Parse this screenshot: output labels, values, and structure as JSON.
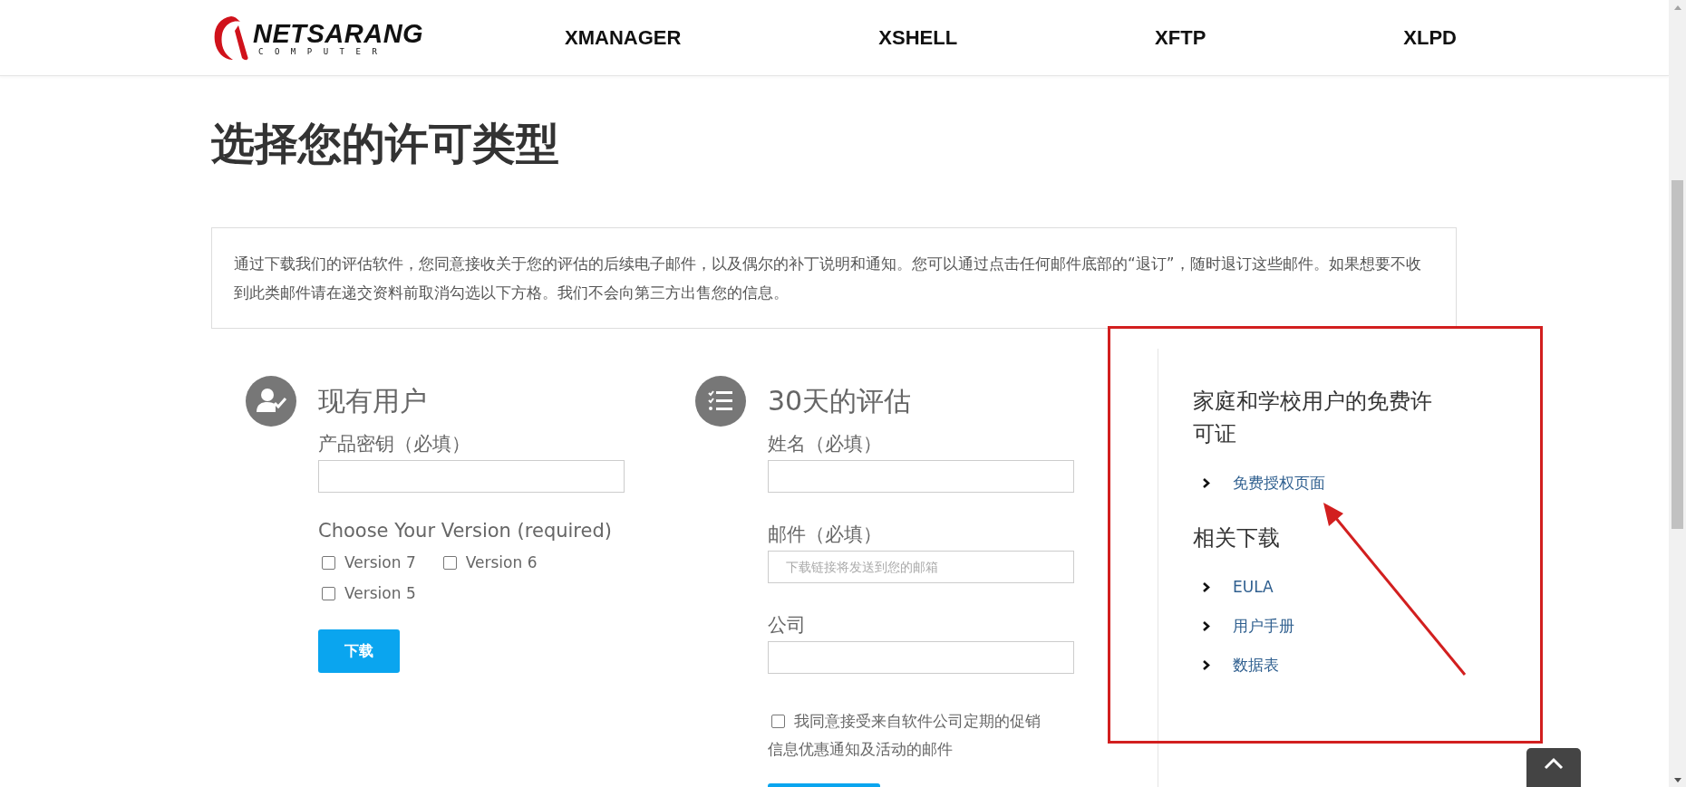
{
  "header": {
    "logo": {
      "name": "NETSARANG",
      "subtitle": "COMPUTER"
    },
    "nav": [
      {
        "label": "XMANAGER"
      },
      {
        "label": "XSHELL"
      },
      {
        "label": "XFTP"
      },
      {
        "label": "XLPD"
      }
    ]
  },
  "page_title": "选择您的许可类型",
  "notice": "通过下载我们的评估软件，您同意接收关于您的评估的后续电子邮件，以及偶尔的补丁说明和通知。您可以通过点击任何邮件底部的“退订”，随时退订这些邮件。如果想要不收到此类邮件请在递交资料前取消勾选以下方格。我们不会向第三方出售您的信息。",
  "existing_user": {
    "heading": "现有用户",
    "fields": [
      {
        "label": "产品密钥（必填）"
      }
    ],
    "version_label": "Choose Your Version (required)",
    "versions": [
      {
        "label": "Version 7",
        "checked": false
      },
      {
        "label": "Version 6",
        "checked": false
      },
      {
        "label": "Version 5",
        "checked": false
      }
    ],
    "button": "下载"
  },
  "trial": {
    "heading": "30天的评估",
    "fields": [
      {
        "label": "姓名（必填）"
      },
      {
        "label": "邮件（必填）",
        "placeholder": "下载链接将发送到您的邮箱"
      },
      {
        "label": "公司"
      }
    ],
    "consent": {
      "label": "我同意接受来自软件公司定期的促销信息优惠通知及活动的邮件",
      "checked": false
    }
  },
  "sidebar": {
    "sections": [
      {
        "heading": "家庭和学校用户的免费许可证",
        "links": [
          "免费授权页面"
        ]
      },
      {
        "heading": "相关下载",
        "links": [
          "EULA",
          "用户手册",
          "数据表"
        ]
      }
    ]
  }
}
